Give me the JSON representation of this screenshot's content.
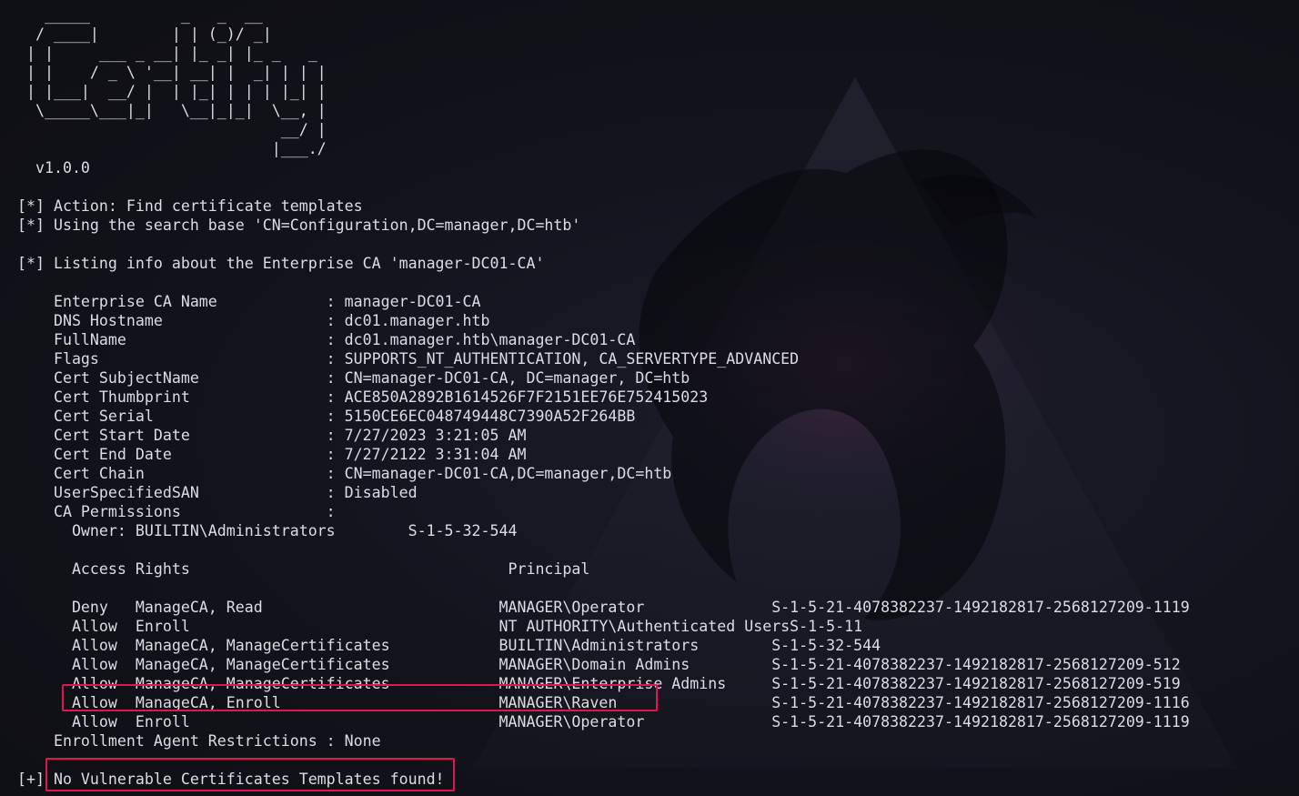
{
  "banner": [
    "   _____          _   _  __",
    "  / ____|        | | (_)/ _|",
    " | |     ___ _ __| |_ _| |_ _   _",
    " | |    / _ \\ '__| __| |  _| | | |",
    " | |___|  __/ |  | |_| | | | |_| |",
    "  \\_____\\___|_|   \\__|_|_|  \\__, |",
    "                             __/ |",
    "                            |___./",
    "  v1.0.0"
  ],
  "output": {
    "action": "[*] Action: Find certificate templates",
    "search_base": "[*] Using the search base 'CN=Configuration,DC=manager,DC=htb'",
    "listing": "[*] Listing info about the Enterprise CA 'manager-DC01-CA'"
  },
  "ca_info": [
    "    Enterprise CA Name            : manager-DC01-CA",
    "    DNS Hostname                  : dc01.manager.htb",
    "    FullName                      : dc01.manager.htb\\manager-DC01-CA",
    "    Flags                         : SUPPORTS_NT_AUTHENTICATION, CA_SERVERTYPE_ADVANCED",
    "    Cert SubjectName              : CN=manager-DC01-CA, DC=manager, DC=htb",
    "    Cert Thumbprint               : ACE850A2892B1614526F7F2151EE76E752415023",
    "    Cert Serial                   : 5150CE6EC048749448C7390A52F264BB",
    "    Cert Start Date               : 7/27/2023 3:21:05 AM",
    "    Cert End Date                 : 7/27/2122 3:31:04 AM",
    "    Cert Chain                    : CN=manager-DC01-CA,DC=manager,DC=htb",
    "    UserSpecifiedSAN              : Disabled",
    "    CA Permissions                :",
    "      Owner: BUILTIN\\Administrators        S-1-5-32-544"
  ],
  "permissions_header": "      Access Rights                                   Principal",
  "permissions": [
    "      Deny   ManageCA, Read                          MANAGER\\Operator              S-1-5-21-4078382237-1492182817-2568127209-1119",
    "      Allow  Enroll                                  NT AUTHORITY\\Authenticated UsersS-1-5-11",
    "      Allow  ManageCA, ManageCertificates            BUILTIN\\Administrators        S-1-5-32-544",
    "      Allow  ManageCA, ManageCertificates            MANAGER\\Domain Admins         S-1-5-21-4078382237-1492182817-2568127209-512",
    "      Allow  ManageCA, ManageCertificates            MANAGER\\Enterprise Admins     S-1-5-21-4078382237-1492182817-2568127209-519",
    "      Allow  ManageCA, Enroll                        MANAGER\\Raven                 S-1-5-21-4078382237-1492182817-2568127209-1116",
    "      Allow  Enroll                                  MANAGER\\Operator              S-1-5-21-4078382237-1492182817-2568127209-1119"
  ],
  "enrollment_restrictions": "    Enrollment Agent Restrictions : None",
  "result": "[+] No Vulnerable Certificates Templates found!",
  "colors": {
    "text": "#dcdce6",
    "highlight": "#e0174f",
    "background": "#0f1117"
  }
}
